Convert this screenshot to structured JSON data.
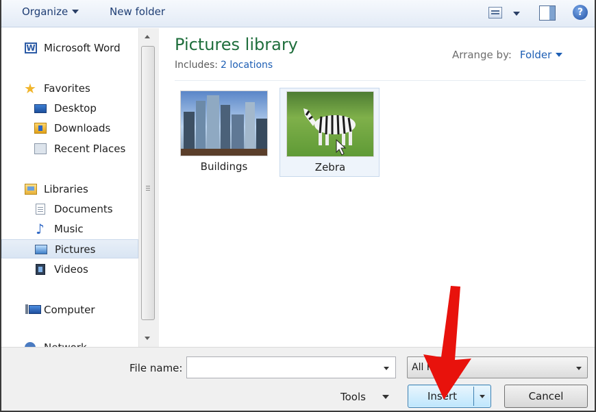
{
  "toolbar": {
    "organize_label": "Organize",
    "new_folder_label": "New folder"
  },
  "sidebar": {
    "items": [
      {
        "label": "Microsoft Word",
        "icon": "word-icon"
      },
      {
        "label": "Favorites",
        "icon": "star-icon"
      },
      {
        "label": "Desktop",
        "icon": "desktop-icon"
      },
      {
        "label": "Downloads",
        "icon": "downloads-icon"
      },
      {
        "label": "Recent Places",
        "icon": "recent-places-icon"
      },
      {
        "label": "Libraries",
        "icon": "libraries-icon"
      },
      {
        "label": "Documents",
        "icon": "documents-icon"
      },
      {
        "label": "Music",
        "icon": "music-icon"
      },
      {
        "label": "Pictures",
        "icon": "pictures-icon",
        "selected": true
      },
      {
        "label": "Videos",
        "icon": "videos-icon"
      },
      {
        "label": "Computer",
        "icon": "computer-icon"
      },
      {
        "label": "Network",
        "icon": "network-icon"
      }
    ]
  },
  "main": {
    "title": "Pictures library",
    "includes_label": "Includes:",
    "includes_link": "2 locations",
    "arrange_label": "Arrange by:",
    "arrange_value": "Folder",
    "files": [
      {
        "name": "Buildings"
      },
      {
        "name": "Zebra",
        "selected": true
      }
    ]
  },
  "footer": {
    "file_name_label": "File name:",
    "file_name_value": "",
    "filter_value": "All Pictures",
    "tools_label": "Tools",
    "insert_label": "Insert",
    "cancel_label": "Cancel"
  },
  "colors": {
    "title_green": "#1f6e3c",
    "link_blue": "#1d5eb4",
    "annotation_red": "#e8120c"
  }
}
